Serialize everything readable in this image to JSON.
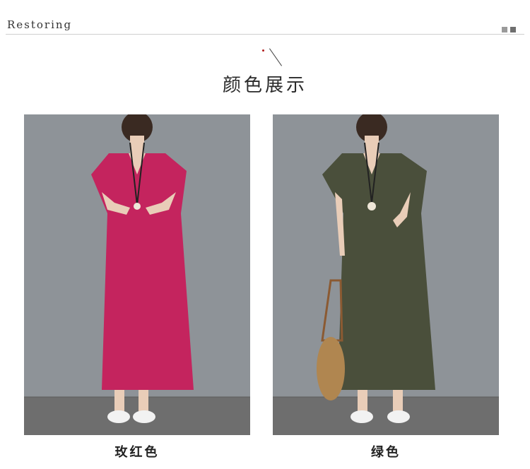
{
  "header": {
    "brand": "Restoring"
  },
  "section": {
    "title": "颜色展示"
  },
  "products": [
    {
      "caption": "玫红色",
      "dress_color": "#c4245e",
      "background": "#8e9398"
    },
    {
      "caption": "绿色",
      "dress_color": "#4a4f3b",
      "background": "#8e9398"
    }
  ]
}
